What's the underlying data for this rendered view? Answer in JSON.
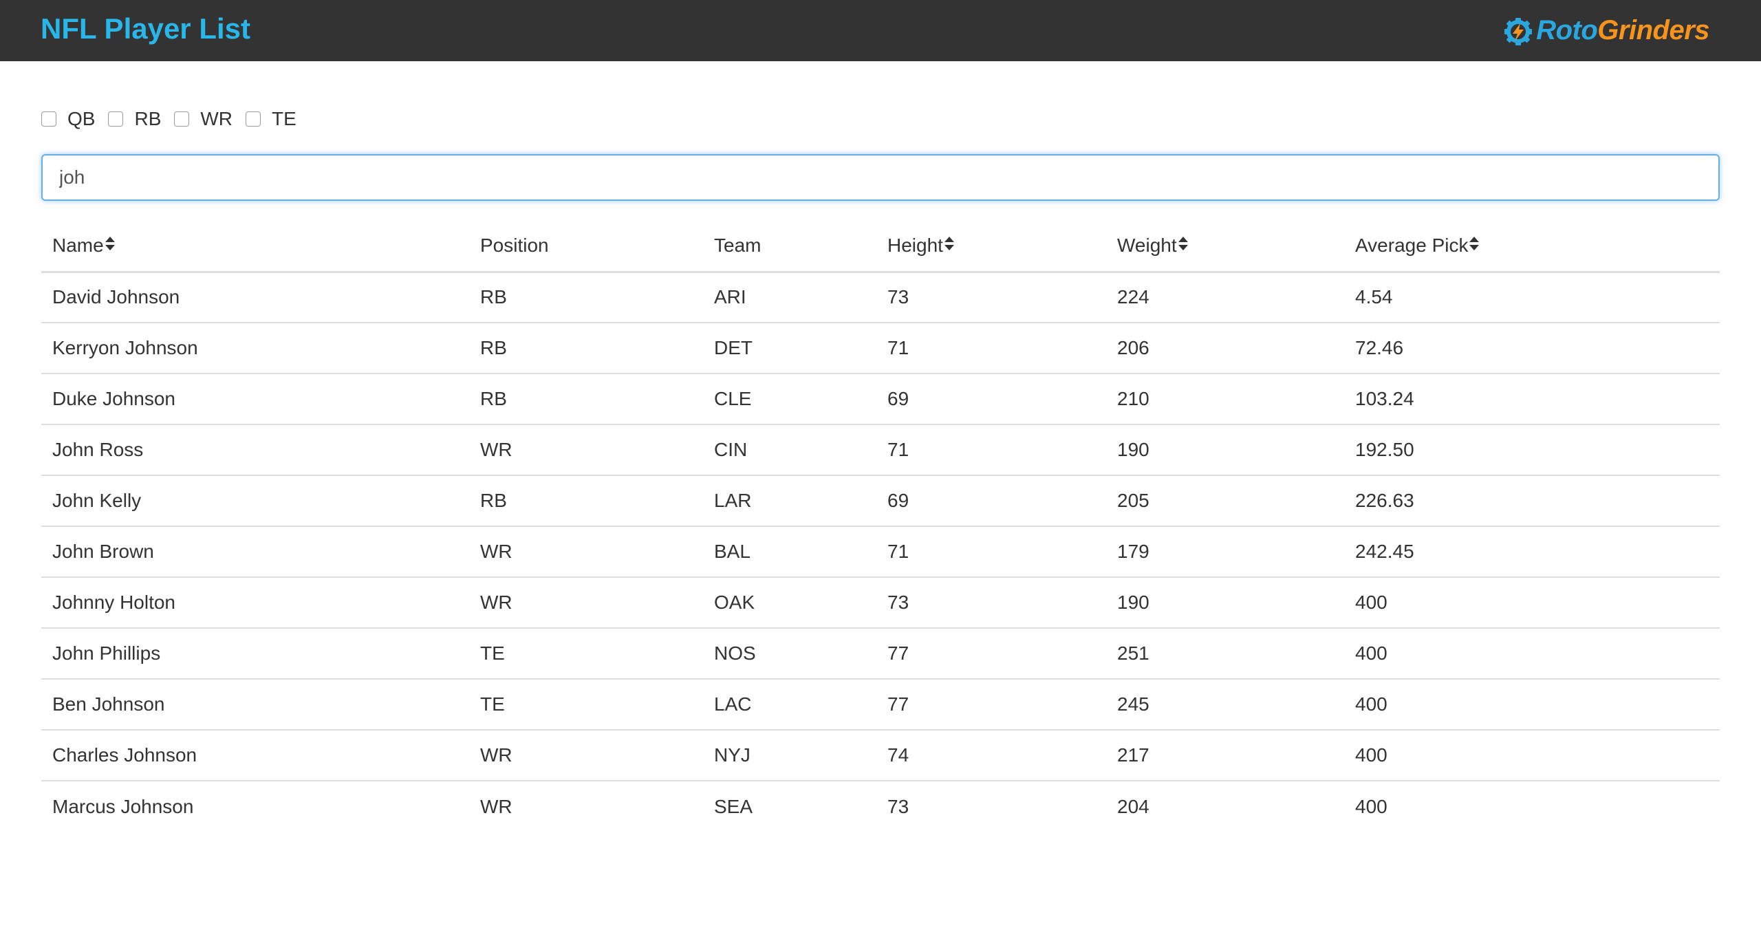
{
  "header": {
    "title": "NFL Player List",
    "logo": {
      "part1": "Roto",
      "part2": "Grinders",
      "icon": "gear-bolt-icon",
      "color1": "#2aa7de",
      "color2": "#f7941d"
    }
  },
  "filters": [
    {
      "label": "QB",
      "checked": false
    },
    {
      "label": "RB",
      "checked": false
    },
    {
      "label": "WR",
      "checked": false
    },
    {
      "label": "TE",
      "checked": false
    }
  ],
  "search": {
    "value": "joh",
    "placeholder": ""
  },
  "table": {
    "columns": [
      {
        "label": "Name",
        "sortable": true
      },
      {
        "label": "Position",
        "sortable": false
      },
      {
        "label": "Team",
        "sortable": false
      },
      {
        "label": "Height",
        "sortable": true
      },
      {
        "label": "Weight",
        "sortable": true
      },
      {
        "label": "Average Pick",
        "sortable": true
      }
    ],
    "rows": [
      [
        "David Johnson",
        "RB",
        "ARI",
        "73",
        "224",
        "4.54"
      ],
      [
        "Kerryon Johnson",
        "RB",
        "DET",
        "71",
        "206",
        "72.46"
      ],
      [
        "Duke Johnson",
        "RB",
        "CLE",
        "69",
        "210",
        "103.24"
      ],
      [
        "John Ross",
        "WR",
        "CIN",
        "71",
        "190",
        "192.50"
      ],
      [
        "John Kelly",
        "RB",
        "LAR",
        "69",
        "205",
        "226.63"
      ],
      [
        "John Brown",
        "WR",
        "BAL",
        "71",
        "179",
        "242.45"
      ],
      [
        "Johnny Holton",
        "WR",
        "OAK",
        "73",
        "190",
        "400"
      ],
      [
        "John Phillips",
        "TE",
        "NOS",
        "77",
        "251",
        "400"
      ],
      [
        "Ben Johnson",
        "TE",
        "LAC",
        "77",
        "245",
        "400"
      ],
      [
        "Charles Johnson",
        "WR",
        "NYJ",
        "74",
        "217",
        "400"
      ],
      [
        "Marcus Johnson",
        "WR",
        "SEA",
        "73",
        "204",
        "400"
      ]
    ]
  },
  "colors": {
    "navbar_bg": "#333333",
    "title": "#29b7ea",
    "focus_border": "#66afe9",
    "row_border": "#dddddd"
  }
}
